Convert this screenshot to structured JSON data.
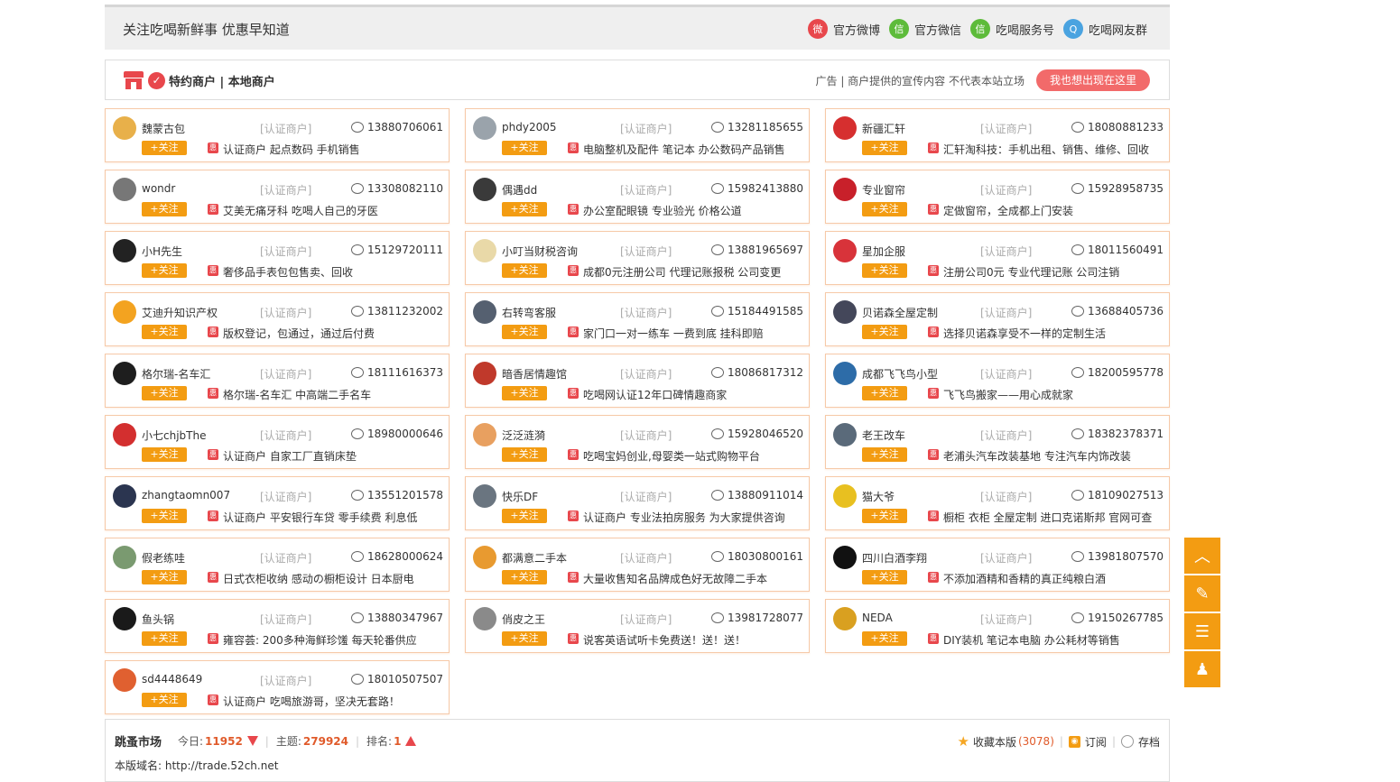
{
  "followbar": {
    "slogan": "关注吃喝新鲜事 优惠早知道",
    "links": [
      {
        "label": "官方微博",
        "icon": "weibo-icon",
        "color": "#e8474c",
        "glyph": "微"
      },
      {
        "label": "官方微信",
        "icon": "wechat-icon",
        "color": "#5dbb3a",
        "glyph": "信"
      },
      {
        "label": "吃喝服务号",
        "icon": "wechat-service-icon",
        "color": "#5dbb3a",
        "glyph": "信"
      },
      {
        "label": "吃喝网友群",
        "icon": "qq-icon",
        "color": "#4aa3e0",
        "glyph": "Q"
      }
    ]
  },
  "merchants_header": {
    "title": "特约商户 | 本地商户",
    "ad_note": "广告 | 商户提供的宣传内容 不代表本站立场",
    "ad_button": "我也想出现在这里"
  },
  "merchants": [
    {
      "name": "魏蒙古包",
      "cert": "[认证商户]",
      "phone": "13880706061",
      "follow": "+关注",
      "badge": "惠",
      "desc": "认证商户 起点数码 手机销售",
      "avatar_color": "#e8b04a"
    },
    {
      "name": "phdy2005",
      "cert": "[认证商户]",
      "phone": "13281185655",
      "follow": "+关注",
      "badge": "惠",
      "desc": "电脑整机及配件 笔记本 办公数码产品销售",
      "avatar_color": "#9aa3ab"
    },
    {
      "name": "新疆汇轩",
      "cert": "[认证商户]",
      "phone": "18080881233",
      "follow": "+关注",
      "badge": "惠",
      "desc": "汇轩淘科技：手机出租、销售、维修、回收",
      "avatar_color": "#d62f2f"
    },
    {
      "name": "wondr",
      "cert": "[认证商户]",
      "phone": "13308082110",
      "follow": "+关注",
      "badge": "惠",
      "desc": "艾美无痛牙科 吃喝人自己的牙医",
      "avatar_color": "#777777"
    },
    {
      "name": "偶遇dd",
      "cert": "[认证商户]",
      "phone": "15982413880",
      "follow": "+关注",
      "badge": "惠",
      "desc": "办公室配眼镜 专业验光 价格公道",
      "avatar_color": "#3a3a3a"
    },
    {
      "name": "专业窗帘",
      "cert": "[认证商户]",
      "phone": "15928958735",
      "follow": "+关注",
      "badge": "惠",
      "desc": "定做窗帘，全成都上门安装",
      "avatar_color": "#c8202a"
    },
    {
      "name": "小H先生",
      "cert": "[认证商户]",
      "phone": "15129720111",
      "follow": "+关注",
      "badge": "惠",
      "desc": "奢侈品手表包包售卖、回收",
      "avatar_color": "#222222"
    },
    {
      "name": "小叮当财税咨询",
      "cert": "[认证商户]",
      "phone": "13881965697",
      "follow": "+关注",
      "badge": "惠",
      "desc": "成都0元注册公司 代理记账报税 公司变更",
      "avatar_color": "#e9d9a8"
    },
    {
      "name": "星加企服",
      "cert": "[认证商户]",
      "phone": "18011560491",
      "follow": "+关注",
      "badge": "惠",
      "desc": "注册公司0元 专业代理记账 公司注销",
      "avatar_color": "#d8333a"
    },
    {
      "name": "艾迪升知识产权",
      "cert": "[认证商户]",
      "phone": "13811232002",
      "follow": "+关注",
      "badge": "惠",
      "desc": "版权登记，包通过，通过后付费",
      "avatar_color": "#f3a320"
    },
    {
      "name": "右转弯客服",
      "cert": "[认证商户]",
      "phone": "15184491585",
      "follow": "+关注",
      "badge": "惠",
      "desc": "家门口一对一练车 一费到底 挂科即赔",
      "avatar_color": "#556070"
    },
    {
      "name": "贝诺森全屋定制",
      "cert": "[认证商户]",
      "phone": "13688405736",
      "follow": "+关注",
      "badge": "惠",
      "desc": "选择贝诺森享受不一样的定制生活",
      "avatar_color": "#44475a"
    },
    {
      "name": "格尔瑞-名车汇",
      "cert": "[认证商户]",
      "phone": "18111616373",
      "follow": "+关注",
      "badge": "惠",
      "desc": "格尔瑞-名车汇 中高端二手名车",
      "avatar_color": "#1e1e1e"
    },
    {
      "name": "暗香居情趣馆",
      "cert": "[认证商户]",
      "phone": "18086817312",
      "follow": "+关注",
      "badge": "惠",
      "desc": "吃喝网认证12年口碑情趣商家",
      "avatar_color": "#c0392b"
    },
    {
      "name": "成都飞飞鸟小型",
      "cert": "[认证商户]",
      "phone": "18200595778",
      "follow": "+关注",
      "badge": "惠",
      "desc": "飞飞鸟搬家——用心成就家",
      "avatar_color": "#2d6ca8"
    },
    {
      "name": "小七chjbThe",
      "cert": "[认证商户]",
      "phone": "18980000646",
      "follow": "+关注",
      "badge": "惠",
      "desc": "认证商户 自家工厂直销床垫",
      "avatar_color": "#d32f2f"
    },
    {
      "name": "泛泛涟漪",
      "cert": "[认证商户]",
      "phone": "15928046520",
      "follow": "+关注",
      "badge": "惠",
      "desc": "吃喝宝妈创业,母婴类一站式购物平台",
      "avatar_color": "#e8a060"
    },
    {
      "name": "老王改车",
      "cert": "[认证商户]",
      "phone": "18382378371",
      "follow": "+关注",
      "badge": "惠",
      "desc": "老浦头汽车改装基地 专注汽车内饰改装",
      "avatar_color": "#5a6a7a"
    },
    {
      "name": "zhangtaomn007",
      "cert": "[认证商户]",
      "phone": "13551201578",
      "follow": "+关注",
      "badge": "惠",
      "desc": "认证商户 平安银行车贷 零手续费 利息低",
      "avatar_color": "#2b3550"
    },
    {
      "name": "快乐DF",
      "cert": "[认证商户]",
      "phone": "13880911014",
      "follow": "+关注",
      "badge": "惠",
      "desc": "认证商户 专业法拍房服务 为大家提供咨询",
      "avatar_color": "#6a7580"
    },
    {
      "name": "猫大爷",
      "cert": "[认证商户]",
      "phone": "18109027513",
      "follow": "+关注",
      "badge": "惠",
      "desc": "橱柜 衣柜 全屋定制 进口克诺斯邦 官网可查",
      "avatar_color": "#e8c020"
    },
    {
      "name": "假老练哇",
      "cert": "[认证商户]",
      "phone": "18628000624",
      "follow": "+关注",
      "badge": "惠",
      "desc": "日式衣柜收纳 感动の橱柜设计 日本厨电",
      "avatar_color": "#7a9a70"
    },
    {
      "name": "都满意二手本",
      "cert": "[认证商户]",
      "phone": "18030800161",
      "follow": "+关注",
      "badge": "惠",
      "desc": "大量收售知名品牌成色好无故障二手本",
      "avatar_color": "#e89a30"
    },
    {
      "name": "四川白酒李翔",
      "cert": "[认证商户]",
      "phone": "13981807570",
      "follow": "+关注",
      "badge": "惠",
      "desc": "不添加酒精和香精的真正纯粮白酒",
      "avatar_color": "#111111"
    },
    {
      "name": "鱼头锅",
      "cert": "[认证商户]",
      "phone": "13880347967",
      "follow": "+关注",
      "badge": "惠",
      "desc": "雍容荟: 200多种海鲜珍馐 每天轮番供应",
      "avatar_color": "#1a1a1a"
    },
    {
      "name": "俏皮之王",
      "cert": "[认证商户]",
      "phone": "13981728077",
      "follow": "+关注",
      "badge": "惠",
      "desc": "说客英语试听卡免费送！送！送！",
      "avatar_color": "#8a8a8a"
    },
    {
      "name": "NEDA",
      "cert": "[认证商户]",
      "phone": "19150267785",
      "follow": "+关注",
      "badge": "惠",
      "desc": "DIY装机 笔记本电脑 办公耗材等销售",
      "avatar_color": "#d9a020"
    },
    {
      "name": "sd4448649",
      "cert": "[认证商户]",
      "phone": "18010507507",
      "follow": "+关注",
      "badge": "惠",
      "desc": "认证商户 吃喝旅游哥，坚决无套路！",
      "avatar_color": "#e06030"
    }
  ],
  "forum": {
    "name": "跳蚤市场",
    "today_label": "今日:",
    "today_value": "11952",
    "topics_label": "主题:",
    "topics_value": "279924",
    "rank_label": "排名:",
    "rank_value": "1",
    "favorite_label": "收藏本版",
    "favorite_count": "(3078)",
    "subscribe_label": "订阅",
    "archive_label": "存档",
    "domain_text": "本版域名: http://trade.52ch.net"
  },
  "sidetools": [
    {
      "name": "back-to-top",
      "icon": "chevron-up-icon",
      "glyph": "︿"
    },
    {
      "name": "post-new",
      "icon": "edit-icon",
      "glyph": "✎"
    },
    {
      "name": "list-view",
      "icon": "list-icon",
      "glyph": "☰"
    },
    {
      "name": "qq-contact",
      "icon": "qq-icon",
      "glyph": "♟"
    }
  ]
}
